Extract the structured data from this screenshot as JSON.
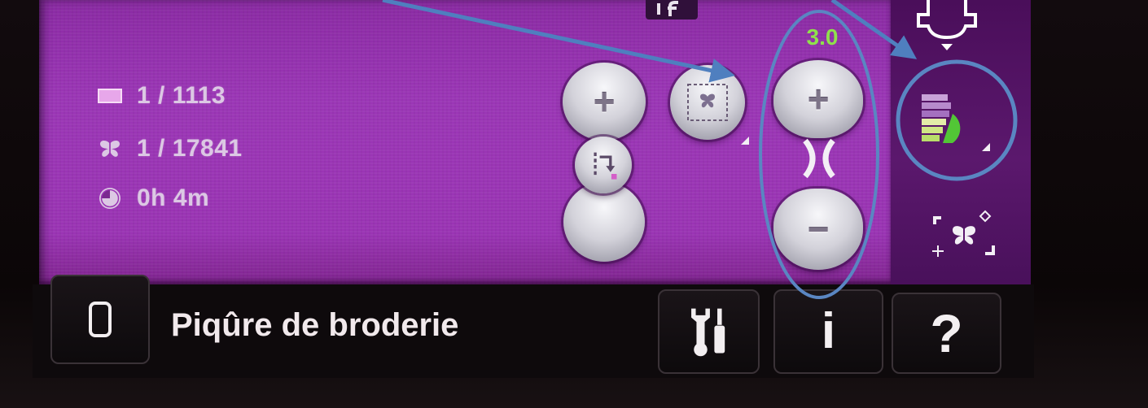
{
  "screen": {
    "design_info": [
      {
        "icon": "color-block-icon",
        "value": "1 / 1113"
      },
      {
        "icon": "butterfly-icon",
        "value": "1 / 17841"
      },
      {
        "icon": "clock-icon",
        "value": "0h 4m"
      }
    ],
    "left_controls": {
      "plus_label": "+"
    },
    "stitch_width": {
      "value": "3.0",
      "plus_label": "+",
      "minus_label": "−"
    }
  },
  "sidebar": {
    "icons": [
      "presser-foot-icon",
      "color-sequence-icon",
      "butterfly-corners-icon"
    ]
  },
  "bottom_bar": {
    "title": "Piqûre de broderie",
    "info_label": "i",
    "help_label": "?",
    "icons": [
      "hoop-icon",
      "tools-icon"
    ]
  },
  "colors": {
    "screen_purple": "#9a34b4",
    "sidebar_purple": "#5b186d",
    "value_green": "#8fe04c",
    "annotation_blue": "#4f7fbf",
    "bezel": "#0b0708"
  }
}
